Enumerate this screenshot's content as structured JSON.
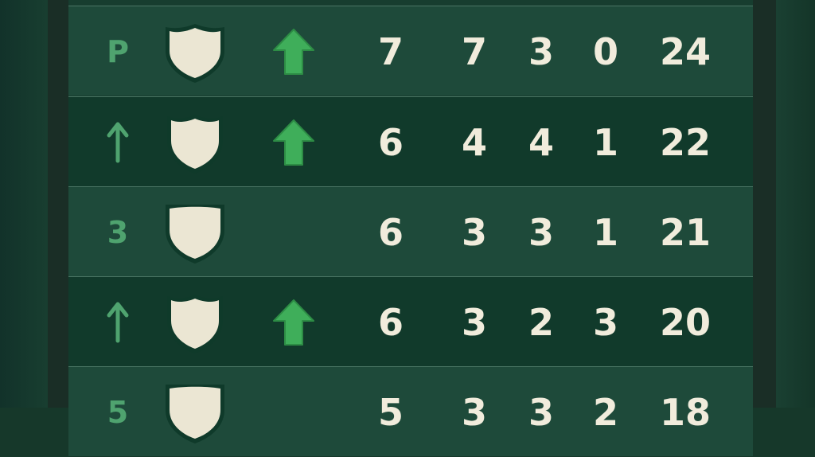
{
  "rows": [
    {
      "pos": "P",
      "pos_icon": "",
      "trend": "up-arrow-icon",
      "stats": [
        "7",
        "7",
        "3",
        "0",
        "24"
      ]
    },
    {
      "pos": "",
      "pos_icon": "up-arrow-outline-icon",
      "trend": "up-arrow-icon",
      "stats": [
        "6",
        "4",
        "4",
        "1",
        "22"
      ]
    },
    {
      "pos": "3",
      "pos_icon": "",
      "trend": "",
      "stats": [
        "6",
        "3",
        "3",
        "1",
        "21"
      ]
    },
    {
      "pos": "",
      "pos_icon": "up-arrow-outline-icon",
      "trend": "up-arrow-icon",
      "stats": [
        "6",
        "3",
        "2",
        "3",
        "20"
      ]
    },
    {
      "pos": "5",
      "pos_icon": "",
      "trend": "",
      "stats": [
        "5",
        "3",
        "3",
        "2",
        "18"
      ]
    }
  ],
  "colors": {
    "background": "#16382a",
    "row_light": "#1e4a3a",
    "row_dark": "#113a2b",
    "text": "#f1ecdc",
    "position_green": "#4fa36f",
    "arrow_green": "#3fae5a",
    "crest_fill": "#ebe6d3"
  }
}
